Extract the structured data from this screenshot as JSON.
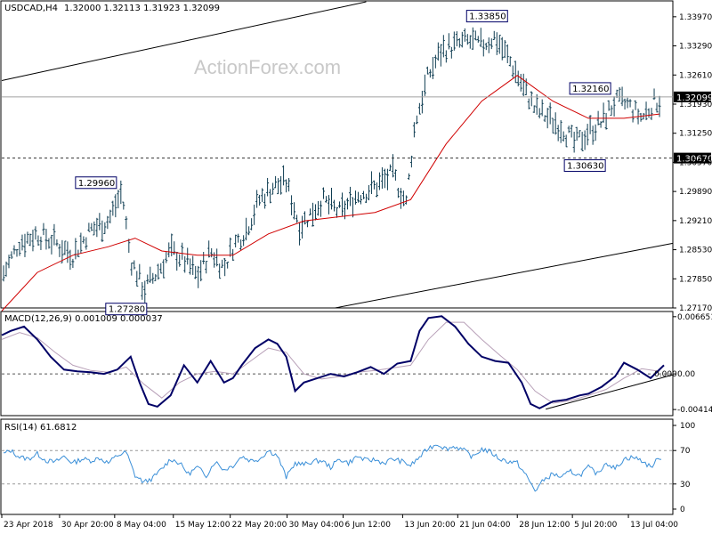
{
  "header": {
    "symbol": "USDCAD,H4",
    "ohlc": "1.32000 1.32113 1.31923 1.32099"
  },
  "watermark": "ActionForex.com",
  "colors": {
    "background": "#ffffff",
    "bar": "#0f3d52",
    "ma": "#d00000",
    "macd_main": "#000066",
    "macd_signal": "#b8a0b8",
    "rsi": "#3a8fd8",
    "channel": "#000000",
    "label_border": "#000066"
  },
  "chart_data": [
    {
      "type": "line",
      "title": "USDCAD,H4",
      "series": [
        {
          "name": "price",
          "x": [
            0,
            20,
            40,
            60,
            80,
            100,
            120,
            135,
            145,
            160,
            175,
            190,
            205,
            220,
            235,
            250,
            260,
            275,
            290,
            305,
            320,
            335,
            345,
            360,
            380,
            400,
            420,
            440,
            455,
            465,
            480,
            495,
            510,
            525,
            540,
            555,
            570,
            585,
            600,
            615,
            630,
            645,
            660,
            675,
            690,
            705,
            720,
            735
          ],
          "values": [
            1.279,
            1.287,
            1.289,
            1.287,
            1.284,
            1.29,
            1.292,
            1.299,
            1.283,
            1.276,
            1.28,
            1.285,
            1.283,
            1.279,
            1.285,
            1.281,
            1.286,
            1.29,
            1.297,
            1.3,
            1.301,
            1.291,
            1.293,
            1.297,
            1.294,
            1.298,
            1.3,
            1.303,
            1.296,
            1.315,
            1.326,
            1.332,
            1.333,
            1.334,
            1.333,
            1.335,
            1.33,
            1.324,
            1.318,
            1.316,
            1.314,
            1.31,
            1.313,
            1.315,
            1.32,
            1.319,
            1.316,
            1.32
          ]
        },
        {
          "name": "ma",
          "x": [
            0,
            40,
            80,
            120,
            150,
            180,
            220,
            260,
            300,
            340,
            380,
            420,
            460,
            500,
            540,
            580,
            620,
            660,
            700,
            740
          ],
          "values": [
            1.271,
            1.28,
            1.284,
            1.286,
            1.288,
            1.285,
            1.284,
            1.284,
            1.289,
            1.292,
            1.293,
            1.294,
            1.297,
            1.31,
            1.32,
            1.326,
            1.32,
            1.316,
            1.316,
            1.317
          ]
        }
      ],
      "xlim": [
        0,
        755
      ],
      "ylim": [
        1.2717,
        1.3432
      ],
      "yticks": [
        1.3397,
        1.3329,
        1.3261,
        1.3193,
        1.3125,
        1.3057,
        1.2989,
        1.2921,
        1.2853,
        1.2785,
        1.2717
      ],
      "ytick_labels": [
        "1.33970",
        "1.33290",
        "1.32610",
        "1.31930",
        "1.31250",
        "1.30570",
        "1.29890",
        "1.29210",
        "1.28530",
        "1.27850",
        "1.27170"
      ],
      "hlines": [
        {
          "value": 1.32099,
          "label": "1.32099",
          "style": "solid"
        },
        {
          "value": 1.3067,
          "label": "1.30670",
          "style": "dashed"
        }
      ],
      "annotations": [
        {
          "text": "1.33850",
          "x": 546,
          "value": 1.3385
        },
        {
          "text": "1.32160",
          "x": 662,
          "value": 1.3216
        },
        {
          "text": "1.30630",
          "x": 656,
          "value": 1.3063
        },
        {
          "text": "1.29960",
          "x": 106,
          "value": 1.2996
        },
        {
          "text": "1.27280",
          "x": 140,
          "value": 1.2728
        }
      ],
      "channel_upper": {
        "x": [
          0,
          410
        ],
        "values": [
          1.3248,
          1.3432
        ]
      },
      "channel_lower": {
        "x": [
          375,
          755
        ],
        "values": [
          1.2717,
          1.2868
        ]
      }
    },
    {
      "type": "line",
      "title": "MACD(12,26,9) 0.001009 0.000037",
      "series": [
        {
          "name": "main",
          "x": [
            0,
            10,
            25,
            40,
            55,
            70,
            85,
            100,
            115,
            130,
            145,
            155,
            165,
            175,
            190,
            205,
            220,
            235,
            250,
            260,
            270,
            285,
            300,
            310,
            320,
            330,
            340,
            355,
            370,
            385,
            400,
            415,
            430,
            445,
            460,
            470,
            480,
            495,
            510,
            525,
            540,
            555,
            570,
            585,
            595,
            605,
            620,
            635,
            650,
            660,
            675,
            690,
            700,
            715,
            730,
            745
          ],
          "values": [
            0.0045,
            0.005,
            0.0055,
            0.004,
            0.002,
            0.0005,
            0.0003,
            0.0002,
            0.0,
            0.0005,
            0.002,
            -0.001,
            -0.0035,
            -0.0038,
            -0.0025,
            0.001,
            -0.001,
            0.0015,
            -0.001,
            -0.0005,
            0.001,
            0.003,
            0.004,
            0.0035,
            0.002,
            -0.002,
            -0.001,
            -0.0005,
            0.0,
            -0.0003,
            0.0002,
            0.0008,
            0.0,
            0.0012,
            0.0015,
            0.005,
            0.0065,
            0.0067,
            0.0055,
            0.0035,
            0.002,
            0.0015,
            0.0013,
            -0.001,
            -0.0035,
            -0.004,
            -0.0032,
            -0.003,
            -0.0025,
            -0.0023,
            -0.0015,
            -0.0003,
            0.0013,
            0.0005,
            -0.0005,
            0.001
          ]
        },
        {
          "name": "signal",
          "x": [
            0,
            20,
            40,
            60,
            80,
            100,
            120,
            140,
            160,
            180,
            200,
            220,
            240,
            260,
            280,
            300,
            320,
            340,
            360,
            380,
            400,
            420,
            440,
            460,
            480,
            500,
            520,
            540,
            560,
            580,
            600,
            620,
            640,
            660,
            680,
            700,
            720,
            740
          ],
          "values": [
            0.004,
            0.0048,
            0.0042,
            0.0025,
            0.001,
            0.0004,
            0.0002,
            0.0008,
            -0.0012,
            -0.0028,
            -0.001,
            0.0,
            0.0003,
            0.0,
            0.0015,
            0.003,
            0.0025,
            0.0,
            -0.0006,
            -0.0003,
            0.0002,
            0.0004,
            0.0007,
            0.001,
            0.004,
            0.006,
            0.006,
            0.004,
            0.0022,
            0.0005,
            -0.002,
            -0.0034,
            -0.0031,
            -0.0025,
            -0.0018,
            -0.0005,
            0.0006,
            0.0003
          ]
        }
      ],
      "xlim": [
        0,
        755
      ],
      "ylim": [
        -0.00485,
        0.00715
      ],
      "yticks": [
        0.006651,
        0.0,
        -0.00414
      ],
      "ytick_labels": [
        "0.006651",
        "0.00",
        "-0.004145"
      ],
      "zero_label": "0.000"
    },
    {
      "type": "line",
      "title": "RSI(14) 61.6812",
      "series": [
        {
          "name": "RSI",
          "x": [
            0,
            10,
            20,
            30,
            40,
            50,
            60,
            70,
            80,
            90,
            100,
            110,
            120,
            130,
            140,
            150,
            160,
            170,
            180,
            190,
            200,
            210,
            220,
            230,
            240,
            250,
            260,
            270,
            280,
            290,
            300,
            310,
            320,
            330,
            340,
            350,
            360,
            370,
            380,
            390,
            400,
            410,
            420,
            430,
            440,
            450,
            460,
            470,
            480,
            490,
            500,
            510,
            520,
            530,
            540,
            550,
            560,
            570,
            580,
            590,
            600,
            610,
            620,
            630,
            640,
            650,
            660,
            670,
            680,
            690,
            700,
            710,
            720,
            730,
            740
          ],
          "values": [
            65,
            70,
            62,
            60,
            66,
            58,
            56,
            63,
            55,
            60,
            58,
            61,
            55,
            64,
            68,
            40,
            32,
            37,
            48,
            60,
            55,
            42,
            50,
            40,
            57,
            47,
            52,
            63,
            58,
            60,
            70,
            64,
            38,
            55,
            53,
            57,
            58,
            50,
            60,
            55,
            63,
            58,
            59,
            55,
            60,
            57,
            52,
            62,
            73,
            78,
            72,
            75,
            70,
            62,
            72,
            68,
            60,
            57,
            55,
            40,
            22,
            35,
            42,
            38,
            45,
            40,
            50,
            42,
            56,
            48,
            60,
            62,
            58,
            50,
            61.68
          ]
        }
      ],
      "xlim": [
        0,
        755
      ],
      "ylim": [
        0,
        100
      ],
      "yticks": [
        100,
        70,
        30,
        0
      ],
      "ytick_labels": [
        "100",
        "70",
        "30",
        "0"
      ],
      "levels": [
        70,
        30
      ]
    }
  ],
  "x_axis": {
    "labels": [
      "23 Apr 2018",
      "30 Apr 20:00",
      "8 May 04:00",
      "15 May 12:00",
      "22 May 20:00",
      "30 May 04:00",
      "6 Jun 12:00",
      "13 Jun 20:00",
      "21 Jun 04:00",
      "28 Jun 12:00",
      "5 Jul 20:00",
      "13 Jul 04:00"
    ],
    "positions": [
      0,
      65,
      127,
      193,
      257,
      321,
      384,
      451,
      513,
      580,
      642,
      705
    ]
  }
}
